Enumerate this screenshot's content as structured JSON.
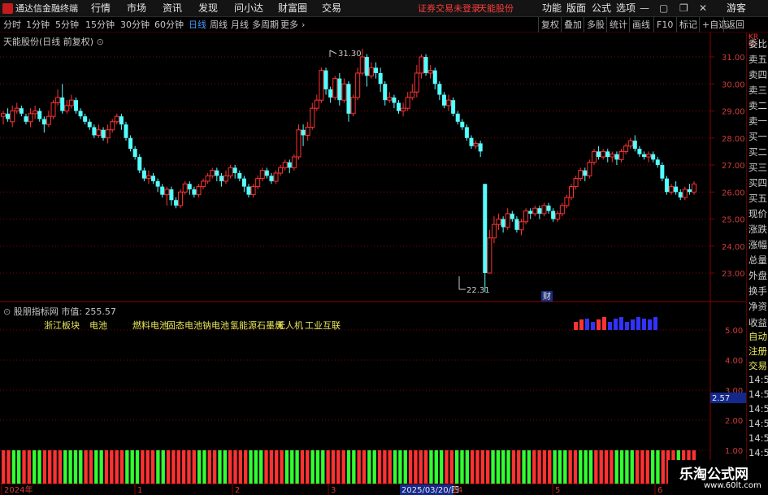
{
  "menubar": {
    "title": "通达信金融终端",
    "items": [
      "行情",
      "市场",
      "资讯",
      "发现",
      "问小达",
      "财富圈",
      "交易"
    ],
    "status": "证券交易未登录",
    "stock": "天能股份",
    "right_items": [
      "功能",
      "版面",
      "公式",
      "选项"
    ],
    "guest": "游客"
  },
  "periods": [
    "分时",
    "1分钟",
    "5分钟",
    "15分钟",
    "30分钟",
    "60分钟",
    "日线",
    "周线",
    "月线",
    "多周期",
    "更多"
  ],
  "active_period": "日线",
  "tools": [
    "复权",
    "叠加",
    "多股",
    "统计",
    "画线",
    "F10",
    "标记",
    "+自选",
    "返回"
  ],
  "chart": {
    "title": "天能股份(日线 前复权)",
    "high_label": "31.30",
    "low_label": "22.31",
    "event_label": "财",
    "price_ticks": [
      "31.00",
      "30.00",
      "29.00",
      "28.00",
      "27.00",
      "26.00",
      "25.00",
      "24.00",
      "23.00"
    ]
  },
  "indicator": {
    "title": "股朋指标网",
    "mv_label": "市值:",
    "mv_value": "255.57",
    "tags": [
      "浙江板块",
      "电池",
      "燃料电池",
      "固态电池",
      "钠电池",
      "氢能源",
      "石墨烯",
      "无人机",
      "工业互联"
    ],
    "ticks": [
      "5.00",
      "4.00",
      "3.00",
      "2.00",
      "1.00"
    ],
    "cursor_value": "2.57"
  },
  "date_axis": {
    "labels": [
      "2024年",
      "1",
      "2",
      "3",
      "4",
      "5",
      "6"
    ],
    "cursor_date": "2025/03/20/四"
  },
  "quote_panel": {
    "top_code": "KR",
    "top_sub": "50",
    "items": [
      "委比",
      "卖五",
      "卖四",
      "卖三",
      "卖二",
      "卖一",
      "买一",
      "买二",
      "买三",
      "买四",
      "买五",
      "现价",
      "涨跌",
      "涨幅",
      "总量",
      "外盘",
      "换手",
      "净资",
      "收益",
      "自动",
      "注册",
      "交易",
      "14:5",
      "14:5",
      "14:5",
      "14:5",
      "14:5",
      "14:5",
      "14:5",
      "14:5",
      "14:5"
    ]
  },
  "watermark": {
    "name": "乐淘公式网",
    "url": "www.60lt.com"
  },
  "colors": {
    "up": "#ff3232",
    "down": "#54ffff",
    "grid": "#8b0000",
    "tag": "#e8e85a",
    "active": "#4a9bff",
    "green_bar": "#32ff32",
    "red_bar": "#ff3232",
    "blue_bar": "#3232ff"
  },
  "chart_data": {
    "type": "candlestick",
    "y_range": [
      22.31,
      31.3
    ],
    "candles": [
      [
        28.8,
        28.9,
        28.5,
        29.0
      ],
      [
        28.9,
        28.7,
        28.6,
        29.1
      ],
      [
        28.6,
        29.0,
        28.4,
        29.2
      ],
      [
        29.0,
        29.1,
        28.9,
        29.3
      ],
      [
        29.1,
        28.9,
        28.8,
        29.2
      ],
      [
        28.8,
        28.6,
        28.5,
        28.9
      ],
      [
        28.6,
        28.9,
        28.4,
        29.1
      ],
      [
        28.9,
        29.0,
        28.7,
        29.2
      ],
      [
        29.0,
        28.7,
        28.6,
        29.1
      ],
      [
        28.7,
        28.5,
        28.2,
        28.8
      ],
      [
        28.5,
        28.8,
        28.4,
        29.0
      ],
      [
        28.8,
        29.3,
        28.7,
        29.4
      ],
      [
        29.3,
        29.5,
        29.2,
        29.8
      ],
      [
        29.5,
        29.0,
        28.9,
        30.0
      ],
      [
        29.0,
        29.2,
        28.9,
        29.4
      ],
      [
        29.2,
        29.4,
        29.1,
        29.6
      ],
      [
        29.4,
        29.0,
        28.9,
        29.5
      ],
      [
        29.0,
        28.8,
        28.7,
        29.1
      ],
      [
        28.8,
        28.6,
        28.5,
        28.9
      ],
      [
        28.6,
        28.4,
        28.3,
        28.7
      ],
      [
        28.4,
        28.1,
        28.0,
        28.5
      ],
      [
        28.1,
        28.3,
        28.0,
        28.5
      ],
      [
        28.3,
        28.0,
        27.9,
        28.4
      ],
      [
        28.0,
        28.3,
        27.8,
        28.5
      ],
      [
        28.3,
        28.6,
        28.2,
        28.7
      ],
      [
        28.6,
        28.8,
        28.5,
        28.9
      ],
      [
        28.8,
        28.5,
        28.3,
        28.9
      ],
      [
        28.5,
        28.0,
        27.9,
        28.6
      ],
      [
        28.0,
        27.6,
        27.5,
        28.1
      ],
      [
        27.6,
        27.3,
        27.2,
        27.7
      ],
      [
        27.3,
        26.8,
        26.7,
        27.4
      ],
      [
        26.8,
        26.5,
        26.4,
        26.9
      ],
      [
        26.5,
        26.6,
        26.3,
        26.8
      ],
      [
        26.6,
        26.4,
        26.3,
        26.7
      ],
      [
        26.4,
        26.2,
        26.0,
        26.5
      ],
      [
        26.2,
        25.9,
        25.8,
        26.3
      ],
      [
        25.9,
        26.1,
        25.5,
        26.2
      ],
      [
        26.1,
        25.7,
        25.5,
        26.2
      ],
      [
        25.7,
        25.5,
        25.4,
        25.8
      ],
      [
        25.5,
        26.0,
        25.4,
        26.1
      ],
      [
        26.0,
        26.3,
        25.9,
        26.4
      ],
      [
        26.3,
        26.1,
        25.9,
        26.4
      ],
      [
        26.1,
        25.9,
        25.8,
        26.2
      ],
      [
        25.9,
        26.2,
        25.8,
        26.3
      ],
      [
        26.2,
        26.4,
        26.1,
        26.5
      ],
      [
        26.4,
        26.6,
        26.3,
        26.7
      ],
      [
        26.6,
        26.8,
        26.5,
        26.9
      ],
      [
        26.8,
        26.6,
        26.4,
        26.9
      ],
      [
        26.6,
        26.4,
        26.2,
        26.7
      ],
      [
        26.4,
        26.6,
        26.3,
        26.8
      ],
      [
        26.6,
        26.9,
        26.5,
        27.0
      ],
      [
        26.9,
        26.7,
        26.5,
        27.0
      ],
      [
        26.7,
        26.5,
        26.4,
        26.8
      ],
      [
        26.5,
        26.2,
        26.0,
        26.6
      ],
      [
        26.2,
        25.9,
        25.8,
        26.3
      ],
      [
        25.9,
        26.2,
        25.8,
        26.3
      ],
      [
        26.2,
        26.5,
        26.1,
        26.6
      ],
      [
        26.5,
        26.8,
        26.4,
        26.9
      ],
      [
        26.8,
        26.6,
        26.5,
        26.9
      ],
      [
        26.6,
        26.4,
        26.3,
        26.7
      ],
      [
        26.4,
        26.7,
        26.3,
        26.8
      ],
      [
        26.7,
        26.9,
        26.6,
        27.0
      ],
      [
        26.9,
        27.1,
        26.8,
        27.2
      ],
      [
        27.1,
        26.9,
        26.7,
        27.2
      ],
      [
        26.9,
        27.3,
        26.8,
        27.4
      ],
      [
        27.3,
        28.3,
        27.2,
        28.5
      ],
      [
        28.3,
        28.1,
        27.7,
        28.5
      ],
      [
        28.1,
        28.4,
        27.9,
        28.6
      ],
      [
        28.4,
        29.1,
        28.3,
        29.3
      ],
      [
        29.1,
        29.4,
        29.0,
        29.6
      ],
      [
        29.4,
        30.5,
        29.3,
        30.6
      ],
      [
        30.5,
        29.8,
        29.6,
        30.6
      ],
      [
        29.8,
        29.5,
        29.3,
        29.9
      ],
      [
        29.5,
        30.2,
        29.4,
        30.3
      ],
      [
        30.2,
        29.4,
        29.2,
        30.4
      ],
      [
        29.4,
        30.0,
        29.3,
        30.2
      ],
      [
        30.0,
        28.9,
        28.6,
        30.1
      ],
      [
        28.9,
        29.5,
        28.8,
        29.6
      ],
      [
        29.5,
        30.4,
        29.4,
        30.6
      ],
      [
        30.4,
        31.0,
        30.3,
        31.3
      ],
      [
        31.0,
        30.3,
        29.9,
        31.1
      ],
      [
        30.3,
        30.6,
        30.2,
        30.8
      ],
      [
        30.6,
        30.4,
        30.2,
        30.8
      ],
      [
        30.4,
        30.0,
        29.7,
        30.6
      ],
      [
        30.0,
        29.4,
        29.2,
        30.1
      ],
      [
        29.4,
        29.5,
        29.3,
        29.7
      ],
      [
        29.5,
        29.3,
        29.1,
        29.6
      ],
      [
        29.3,
        29.0,
        28.9,
        29.4
      ],
      [
        29.0,
        29.1,
        28.8,
        29.3
      ],
      [
        29.1,
        29.5,
        29.0,
        29.7
      ],
      [
        29.5,
        29.7,
        29.4,
        30.0
      ],
      [
        29.7,
        30.4,
        29.5,
        30.7
      ],
      [
        30.4,
        31.0,
        30.2,
        31.1
      ],
      [
        31.0,
        30.4,
        30.3,
        31.1
      ],
      [
        30.4,
        30.5,
        30.2,
        30.7
      ],
      [
        30.5,
        30.0,
        29.8,
        30.6
      ],
      [
        30.0,
        29.6,
        29.4,
        30.1
      ],
      [
        29.6,
        29.2,
        29.1,
        29.7
      ],
      [
        29.2,
        29.4,
        29.0,
        29.6
      ],
      [
        29.4,
        28.9,
        28.8,
        29.5
      ],
      [
        28.9,
        28.6,
        28.5,
        29.0
      ],
      [
        28.6,
        28.4,
        28.3,
        28.7
      ],
      [
        28.4,
        28.0,
        27.9,
        28.5
      ],
      [
        28.0,
        27.7,
        27.6,
        28.1
      ],
      [
        27.7,
        27.8,
        27.6,
        27.9
      ],
      [
        27.8,
        27.5,
        27.3,
        27.9
      ],
      [
        26.3,
        23.0,
        22.31,
        26.3
      ],
      [
        23.0,
        24.3,
        23.0,
        24.6
      ],
      [
        24.3,
        24.8,
        24.1,
        25.1
      ],
      [
        24.8,
        25.0,
        24.6,
        25.2
      ],
      [
        25.0,
        24.7,
        24.5,
        25.1
      ],
      [
        24.7,
        25.2,
        24.6,
        25.4
      ],
      [
        25.2,
        25.0,
        24.9,
        25.3
      ],
      [
        25.0,
        24.6,
        24.5,
        25.1
      ],
      [
        24.6,
        24.9,
        24.4,
        25.0
      ],
      [
        24.9,
        25.3,
        24.8,
        25.4
      ],
      [
        25.3,
        25.2,
        25.0,
        25.4
      ],
      [
        25.2,
        25.4,
        25.1,
        25.5
      ],
      [
        25.4,
        25.2,
        25.0,
        25.5
      ],
      [
        25.2,
        25.5,
        25.1,
        25.6
      ],
      [
        25.5,
        25.3,
        25.2,
        25.6
      ],
      [
        25.3,
        25.0,
        24.9,
        25.4
      ],
      [
        25.0,
        25.2,
        24.9,
        25.3
      ],
      [
        25.2,
        25.5,
        25.1,
        25.6
      ],
      [
        25.5,
        25.8,
        25.4,
        25.9
      ],
      [
        25.8,
        26.2,
        25.7,
        26.3
      ],
      [
        26.2,
        26.5,
        26.1,
        26.6
      ],
      [
        26.5,
        26.8,
        26.4,
        26.9
      ],
      [
        26.8,
        26.6,
        26.4,
        26.9
      ],
      [
        26.6,
        27.1,
        26.5,
        27.2
      ],
      [
        27.1,
        27.5,
        27.0,
        27.6
      ],
      [
        27.5,
        27.3,
        27.2,
        27.7
      ],
      [
        27.3,
        27.5,
        27.2,
        27.6
      ],
      [
        27.5,
        27.3,
        27.1,
        27.6
      ],
      [
        27.3,
        27.4,
        27.1,
        27.5
      ],
      [
        27.4,
        27.2,
        27.0,
        27.5
      ],
      [
        27.2,
        27.5,
        27.1,
        27.6
      ],
      [
        27.5,
        27.7,
        27.4,
        27.8
      ],
      [
        27.7,
        27.9,
        27.6,
        28.0
      ],
      [
        27.9,
        27.6,
        27.5,
        28.1
      ],
      [
        27.6,
        27.4,
        27.3,
        27.7
      ],
      [
        27.4,
        27.3,
        27.2,
        27.5
      ],
      [
        27.3,
        27.4,
        27.1,
        27.5
      ],
      [
        27.4,
        27.2,
        27.1,
        27.5
      ],
      [
        27.2,
        27.0,
        26.9,
        27.3
      ],
      [
        27.0,
        26.5,
        26.4,
        27.1
      ],
      [
        26.5,
        26.0,
        25.9,
        26.6
      ],
      [
        26.0,
        26.2,
        25.9,
        26.3
      ],
      [
        26.2,
        26.0,
        25.9,
        26.4
      ],
      [
        26.0,
        25.8,
        25.7,
        26.1
      ],
      [
        25.8,
        26.1,
        25.7,
        26.2
      ],
      [
        26.1,
        26.0,
        25.9,
        26.3
      ],
      [
        26.0,
        26.3,
        25.9,
        26.4
      ]
    ],
    "indicator_bars": [
      "r",
      "r",
      "b",
      "b",
      "r",
      "r",
      "b",
      "b",
      "b",
      "b",
      "b",
      "b",
      "b",
      "b",
      "b"
    ],
    "bottom_bars": "RRGGRRGGRRRRGGGGRRGGRRRRGGGRRRGGRRRRRRGGRRGGRRRRGGGRRRRGGGRRGGGRRRRGGRRGGRRRGGGRRRRGGGRRGGGRRRRGGGGRRGGRRRRGGGRRGGGRRRRGGGGRRRGGRRRGRRR"
  }
}
